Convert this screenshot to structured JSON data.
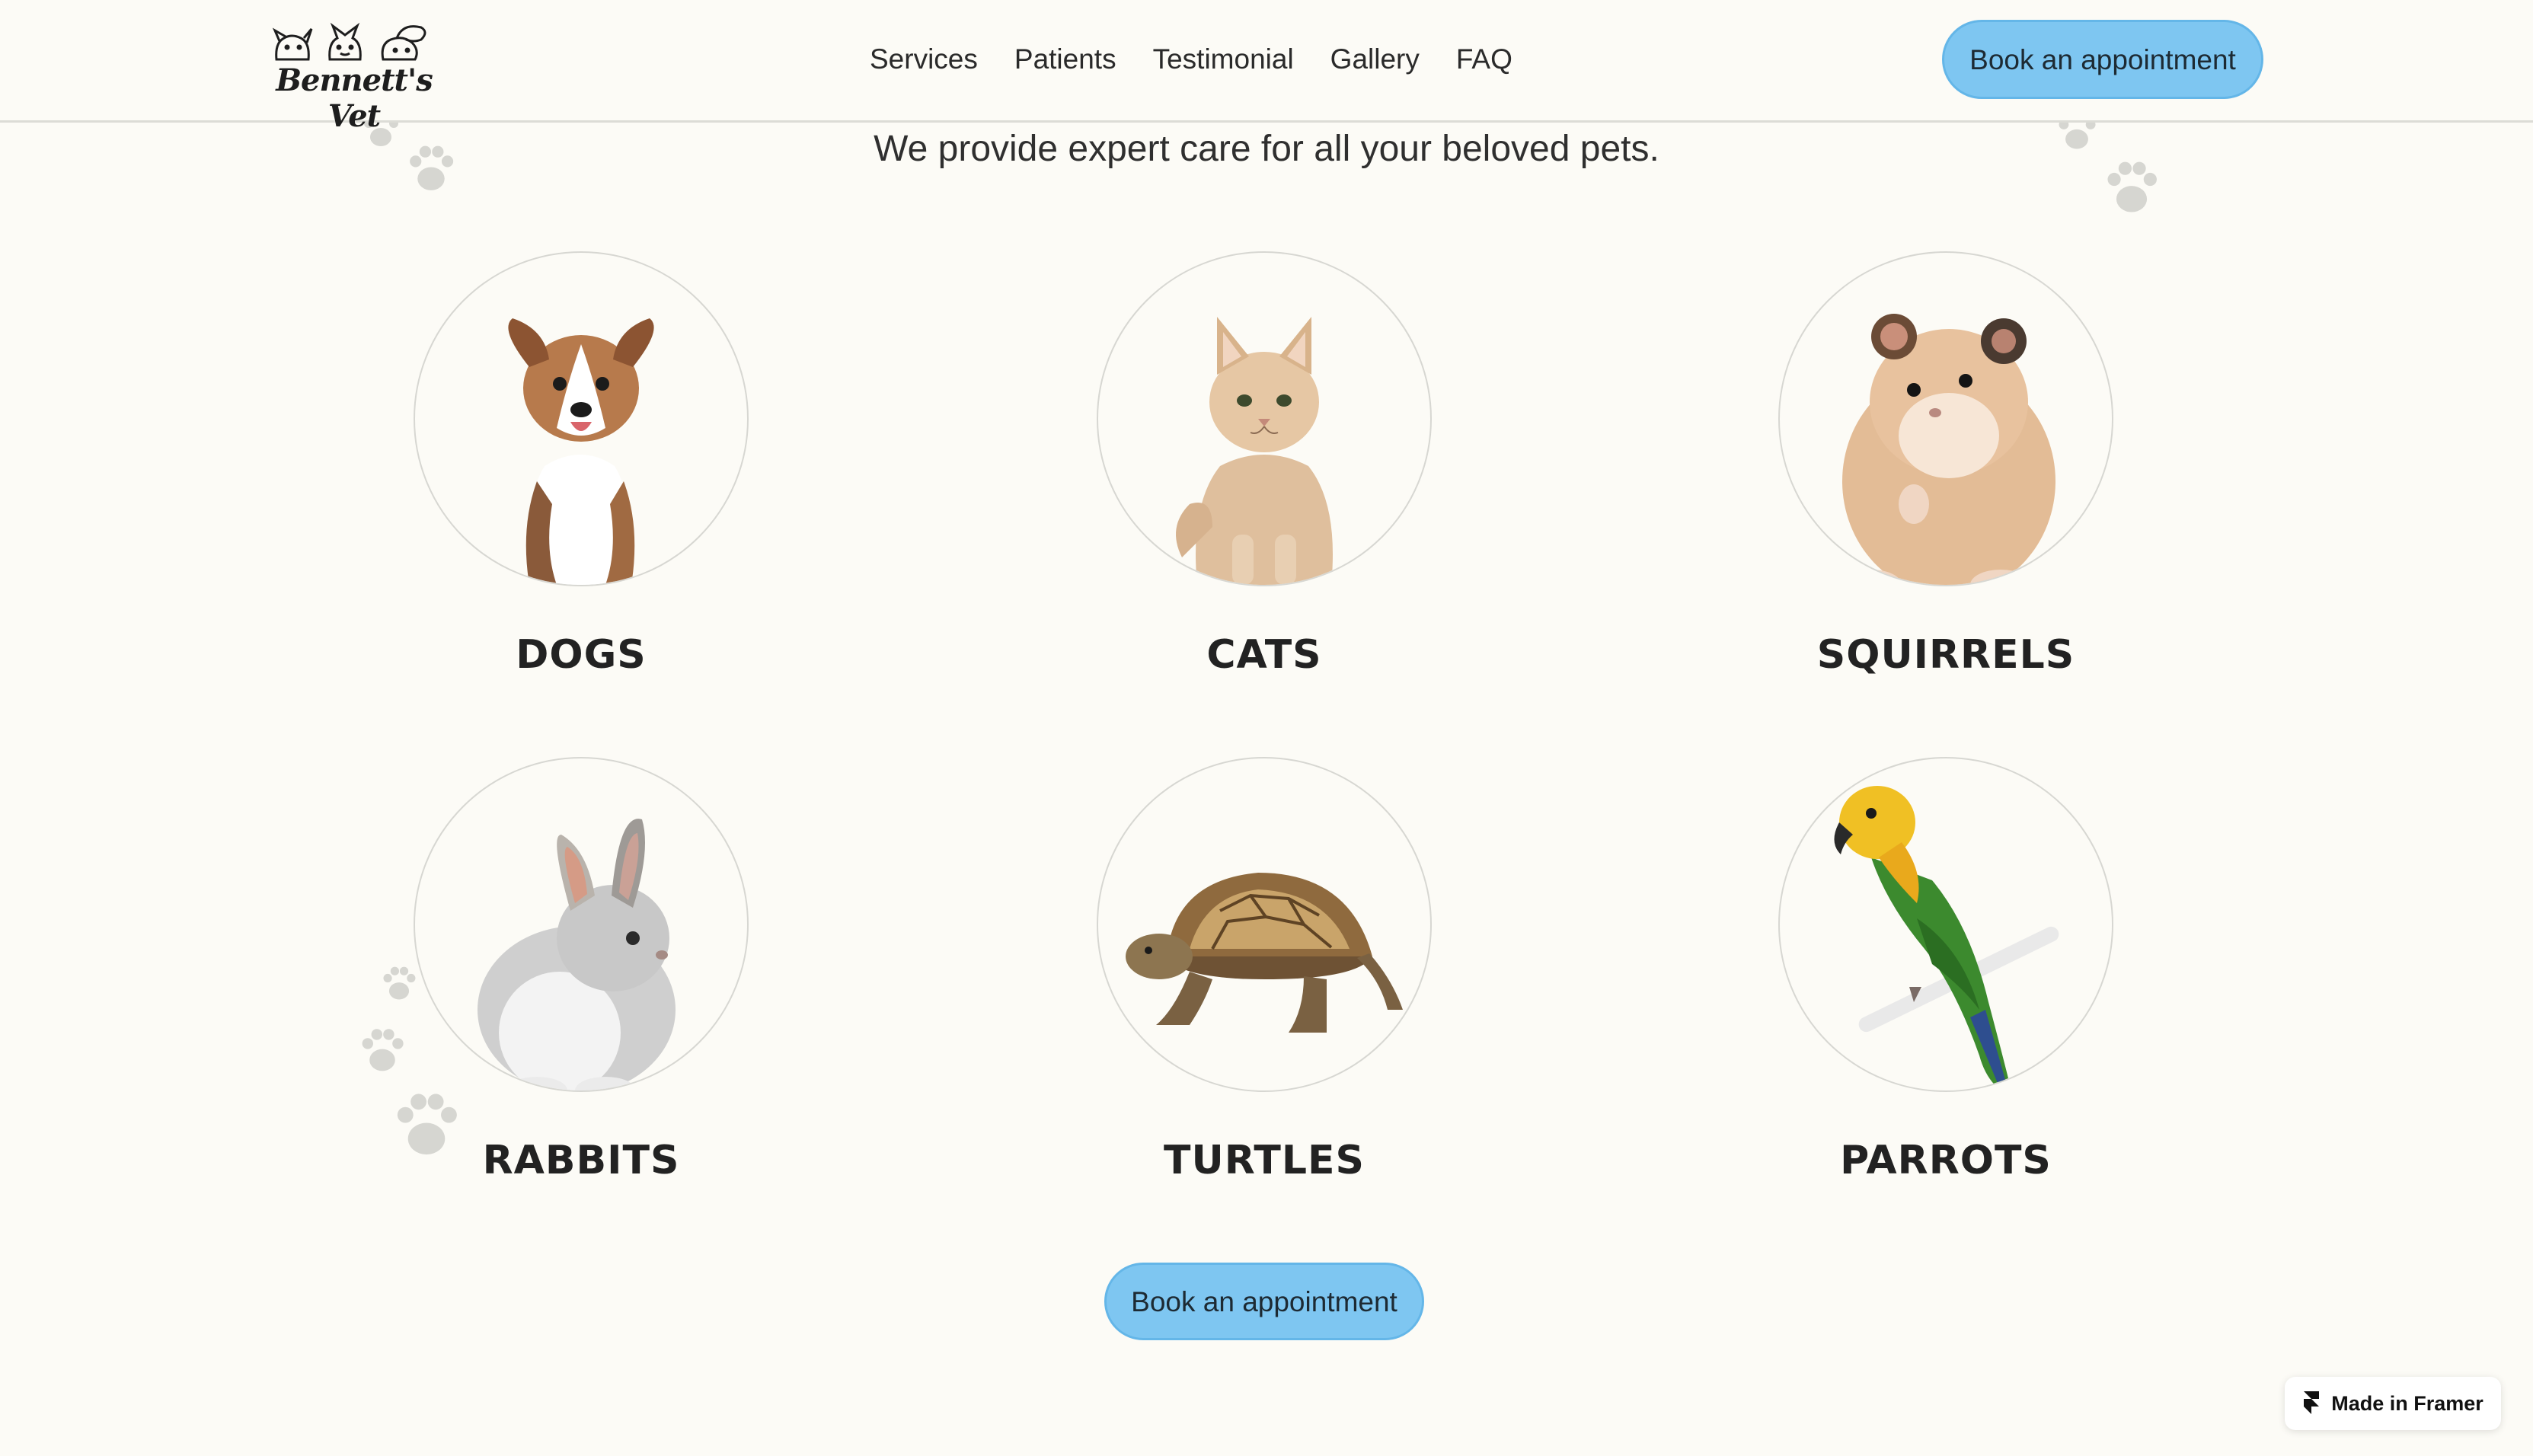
{
  "header": {
    "logo_text": "Bennett's Vet",
    "nav": [
      {
        "label": "Services"
      },
      {
        "label": "Patients"
      },
      {
        "label": "Testimonial"
      },
      {
        "label": "Gallery"
      },
      {
        "label": "FAQ"
      }
    ],
    "cta_label": "Book an appointment"
  },
  "main": {
    "subtitle": "We provide expert care for all your beloved pets.",
    "pets": [
      {
        "label": "DOGS",
        "icon": "dog-icon"
      },
      {
        "label": "CATS",
        "icon": "cat-icon"
      },
      {
        "label": "SQUIRRELS",
        "icon": "hamster-icon"
      },
      {
        "label": "RABBITS",
        "icon": "rabbit-icon"
      },
      {
        "label": "TURTLES",
        "icon": "turtle-icon"
      },
      {
        "label": "PARROTS",
        "icon": "parrot-icon"
      }
    ],
    "cta_label": "Book an appointment"
  },
  "badge": {
    "label": "Made in Framer"
  },
  "colors": {
    "background": "#fcfbf6",
    "button": "#7ec6f1",
    "button_border": "#64b6e8",
    "paw": "#d6d6d1"
  }
}
